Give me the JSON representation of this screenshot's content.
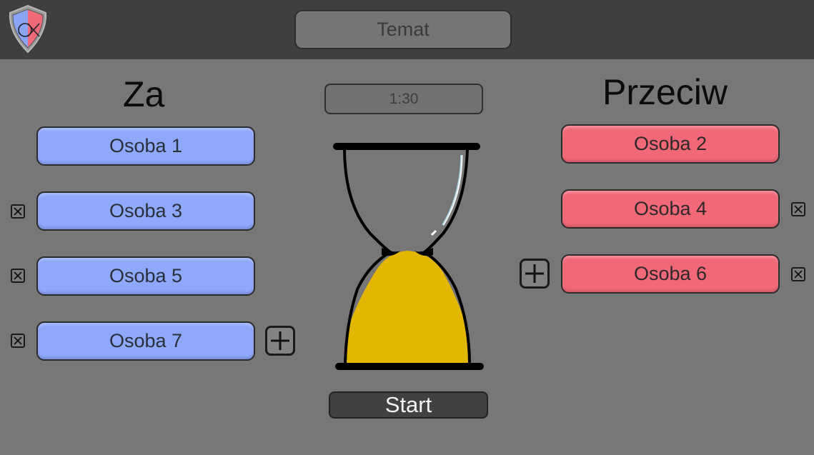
{
  "topbar": {
    "logo_icon": "shield-logo-icon",
    "topic_placeholder": "Temat"
  },
  "timer": {
    "value": "1:30"
  },
  "sides": {
    "for": {
      "heading": "Za",
      "color": "#8fa8fc",
      "people": [
        "Osoba 1",
        "Osoba 3",
        "Osoba 5",
        "Osoba 7"
      ]
    },
    "against": {
      "heading": "Przeciw",
      "color": "#f16979",
      "people": [
        "Osoba 2",
        "Osoba 4",
        "Osoba 6"
      ]
    }
  },
  "hourglass": {
    "icon": "hourglass-icon",
    "sand_color": "#e3b600"
  },
  "controls": {
    "start_label": "Start",
    "add_icon": "plus-icon",
    "remove_icon": "close-box-icon"
  }
}
